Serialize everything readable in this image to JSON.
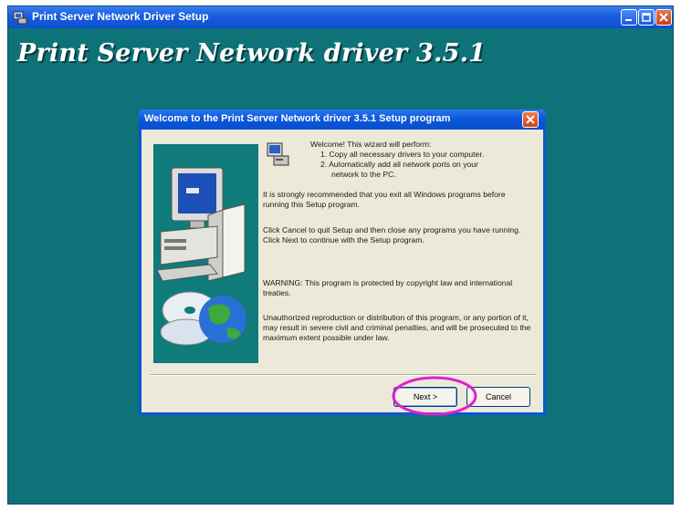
{
  "outer_window": {
    "title": "Print Server Network Driver Setup",
    "banner_title": "Print Server Network driver 3.5.1"
  },
  "dialog": {
    "title": "Welcome to the Print Server Network driver 3.5.1 Setup program",
    "welcome_line": "Welcome! This wizard will perform:",
    "steps": [
      "1. Copy all necessary drivers to your computer.",
      "2. Automatically add all network ports on your",
      "network to the PC."
    ],
    "paragraph_1": "It is strongly recommended that you exit all Windows programs before running this Setup program.",
    "paragraph_2": "Click Cancel to quit Setup and then close any programs you have running.  Click Next to continue with the Setup program.",
    "warning": "WARNING: This program is protected by copyright law and international treaties.",
    "legal": "Unauthorized reproduction or distribution of this program, or any portion of it, may result in severe civil and criminal penalties, and will be prosecuted to the maximum extent possible under law.",
    "buttons": {
      "next": "Next >",
      "cancel": "Cancel"
    }
  },
  "colors": {
    "desktop_teal": "#0e7378",
    "titlebar_blue": "#0a57d8",
    "dialog_bg": "#ece9d8",
    "highlight_magenta": "#e020d0"
  },
  "icons": [
    "setup-app-icon",
    "minimize-icon",
    "maximize-icon",
    "close-icon",
    "computer-illustration",
    "cd-globe-illustration",
    "wizard-computer-icon"
  ]
}
